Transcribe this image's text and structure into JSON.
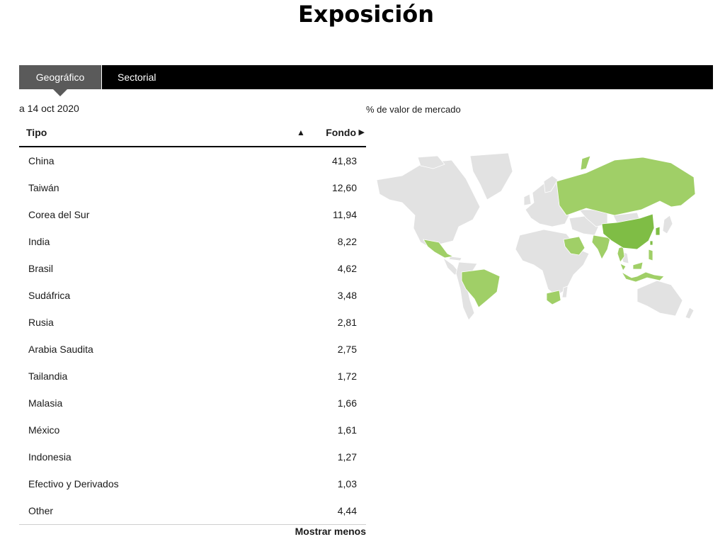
{
  "page": {
    "title": "Exposición"
  },
  "tabs": [
    {
      "label": "Geográfico",
      "active": true
    },
    {
      "label": "Sectorial",
      "active": false
    }
  ],
  "as_of": "a 14 oct 2020",
  "map": {
    "caption": "% de valor de mercado",
    "highlight_color": "#a0cf67",
    "strong_color": "#7fbd45",
    "land_color": "#e2e2e2"
  },
  "table": {
    "col_type": "Tipo",
    "col_fund": "Fondo",
    "sort_up_icon": "▲",
    "sort_right_icon": "▶",
    "rows": [
      {
        "name": "China",
        "value": "41,83"
      },
      {
        "name": "Taiwán",
        "value": "12,60"
      },
      {
        "name": "Corea del Sur",
        "value": "11,94"
      },
      {
        "name": "India",
        "value": "8,22"
      },
      {
        "name": "Brasil",
        "value": "4,62"
      },
      {
        "name": "Sudáfrica",
        "value": "3,48"
      },
      {
        "name": "Rusia",
        "value": "2,81"
      },
      {
        "name": "Arabia Saudita",
        "value": "2,75"
      },
      {
        "name": "Tailandia",
        "value": "1,72"
      },
      {
        "name": "Malasia",
        "value": "1,66"
      },
      {
        "name": "México",
        "value": "1,61"
      },
      {
        "name": "Indonesia",
        "value": "1,27"
      },
      {
        "name": "Efectivo y Derivados",
        "value": "1,03"
      },
      {
        "name": "Other",
        "value": "4,44"
      }
    ],
    "show_less": "Mostrar menos"
  }
}
